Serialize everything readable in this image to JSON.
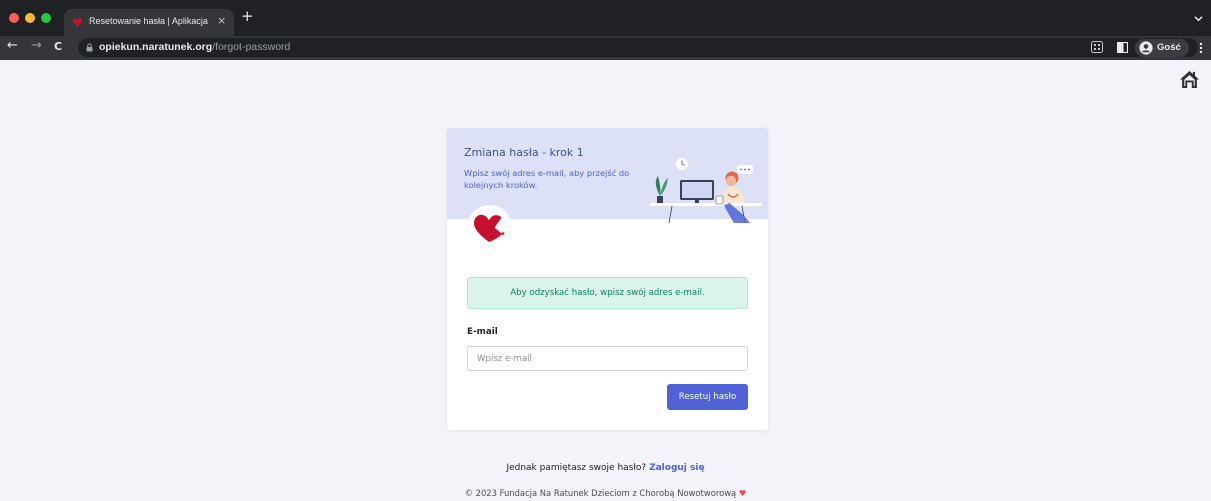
{
  "browser": {
    "tab_title": "Resetowanie hasła | Aplikacja N",
    "close_glyph": "×",
    "new_tab_glyph": "+",
    "url_host": "opiekun.naratunek.org",
    "url_path": "/forgot-password",
    "profile_label": "Gość",
    "nav": {
      "back": "←",
      "forward": "→",
      "reload": "C"
    },
    "traffic_colors": [
      "#ff5f57",
      "#febc2e",
      "#28c840"
    ]
  },
  "page": {
    "home_icon": "home-icon",
    "header_title": "Zmiana hasła - krok 1",
    "header_subtitle": "Wpisz swój adres e-mail, aby przejść do kolejnych kroków.",
    "alert_text": "Aby odzyskać hasło, wpisz swój adres e-mail.",
    "email_label": "E-mail",
    "email_placeholder": "Wpisz e-mail",
    "submit_label": "Resetuj hasło",
    "remember_text": "Jednak pamiętasz swoje hasło?",
    "login_link": "Zaloguj się",
    "footer_text": "© 2023 Fundacja Na Ratunek Dzieciom z Chorobą Nowotworową",
    "footer_heart": "♥",
    "colors": {
      "primary": "#4f62d6",
      "header_bg": "#dde1f8",
      "alert_bg": "#daf4ec",
      "brand_red": "#c8102e"
    }
  }
}
